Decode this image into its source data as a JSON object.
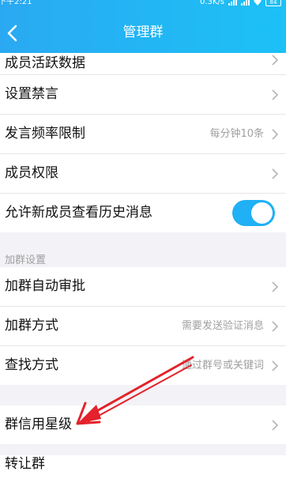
{
  "status": {
    "time": "下午2:21",
    "network": "0.3K/s",
    "battery": "84"
  },
  "header": {
    "title": "管理群"
  },
  "rows": [
    {
      "label": "成员活跃数据",
      "value": ""
    },
    {
      "label": "设置禁言",
      "value": ""
    },
    {
      "label": "发言频率限制",
      "value": "每分钟10条"
    },
    {
      "label": "成员权限",
      "value": ""
    },
    {
      "label": "允许新成员查看历史消息",
      "toggle": true
    }
  ],
  "join_section": {
    "header": "加群设置",
    "rows": [
      {
        "label": "加群自动审批",
        "value": ""
      },
      {
        "label": "加群方式",
        "value": "需要发送验证消息"
      },
      {
        "label": "查找方式",
        "value": "通过群号或关键词"
      }
    ]
  },
  "credit_row": {
    "label": "群信用星级"
  },
  "transfer_row": {
    "label": "转让群"
  },
  "colors": {
    "accent": "#1fb0f5",
    "annotation_arrow": "#e3222b"
  }
}
